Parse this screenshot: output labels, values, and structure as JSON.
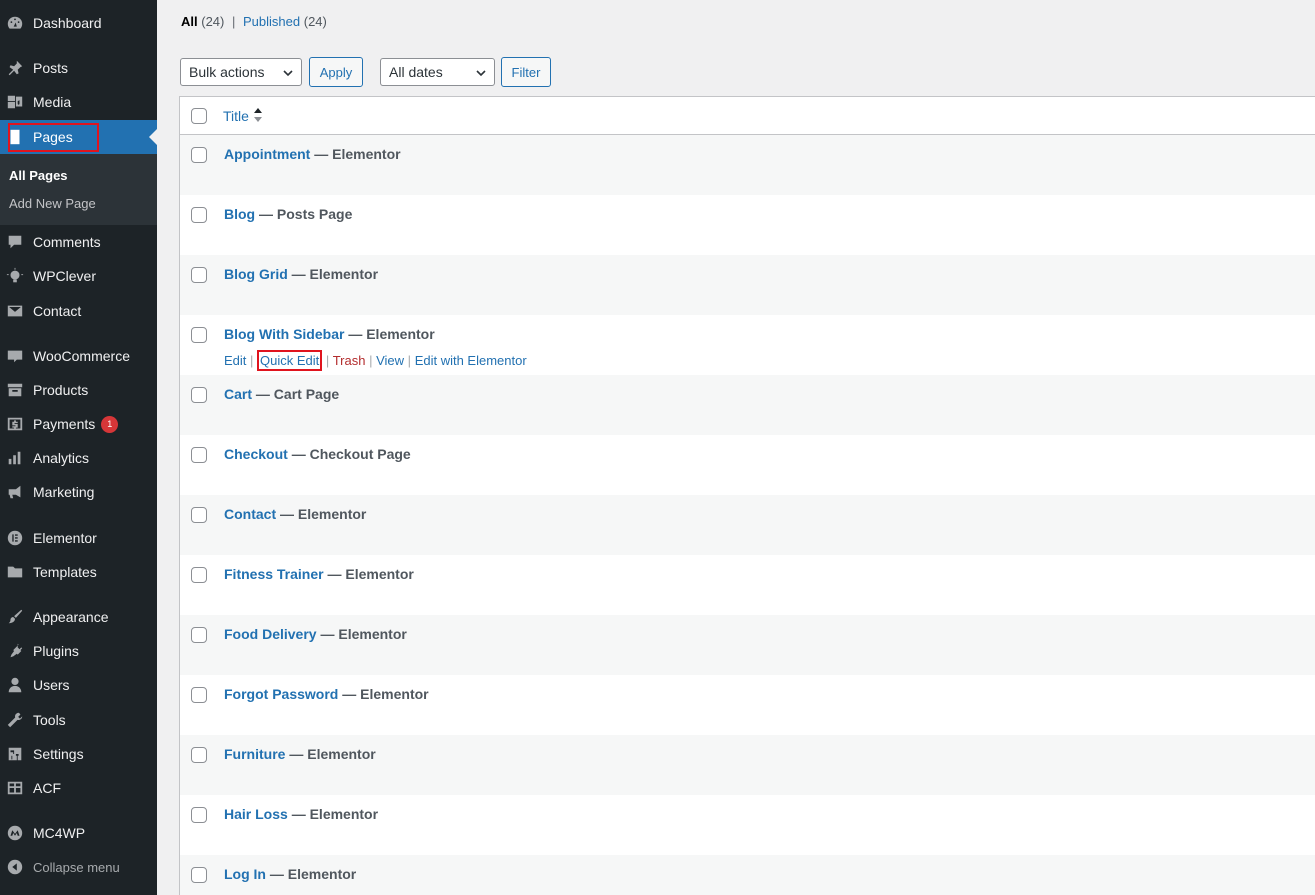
{
  "sidebar": {
    "items": [
      {
        "label": "Dashboard"
      },
      {
        "label": "Posts"
      },
      {
        "label": "Media"
      },
      {
        "label": "Pages"
      },
      {
        "label": "Comments"
      },
      {
        "label": "WPClever"
      },
      {
        "label": "Contact"
      },
      {
        "label": "WooCommerce"
      },
      {
        "label": "Products"
      },
      {
        "label": "Payments",
        "badge": "1"
      },
      {
        "label": "Analytics"
      },
      {
        "label": "Marketing"
      },
      {
        "label": "Elementor"
      },
      {
        "label": "Templates"
      },
      {
        "label": "Appearance"
      },
      {
        "label": "Plugins"
      },
      {
        "label": "Users"
      },
      {
        "label": "Tools"
      },
      {
        "label": "Settings"
      },
      {
        "label": "ACF"
      },
      {
        "label": "MC4WP"
      }
    ],
    "submenu": {
      "all_pages": "All Pages",
      "add_new": "Add New Page"
    },
    "collapse": "Collapse menu",
    "active_color": "#2271b1"
  },
  "filters": {
    "all_label": "All",
    "all_count": "(24)",
    "sep": "|",
    "published_label": "Published",
    "published_count": "(24)"
  },
  "toolbar": {
    "bulk_actions": "Bulk actions",
    "apply": "Apply",
    "dates": "All dates",
    "filter": "Filter"
  },
  "table": {
    "title_header": "Title",
    "rows": [
      {
        "title": "Appointment",
        "state": "— Elementor"
      },
      {
        "title": "Blog",
        "state": "— Posts Page"
      },
      {
        "title": "Blog Grid",
        "state": "— Elementor"
      },
      {
        "title": "Blog With Sidebar",
        "state": "— Elementor"
      },
      {
        "title": "Cart",
        "state": "— Cart Page"
      },
      {
        "title": "Checkout",
        "state": "— Checkout Page"
      },
      {
        "title": "Contact",
        "state": "— Elementor"
      },
      {
        "title": "Fitness Trainer",
        "state": "— Elementor"
      },
      {
        "title": "Food Delivery",
        "state": "— Elementor"
      },
      {
        "title": "Forgot Password",
        "state": "— Elementor"
      },
      {
        "title": "Furniture",
        "state": "— Elementor"
      },
      {
        "title": "Hair Loss",
        "state": "— Elementor"
      },
      {
        "title": "Log In",
        "state": "— Elementor"
      }
    ],
    "row_actions": {
      "edit": "Edit",
      "quick_edit": "Quick Edit",
      "trash": "Trash",
      "view": "View",
      "edit_elementor": "Edit with Elementor",
      "sep": "|"
    }
  }
}
